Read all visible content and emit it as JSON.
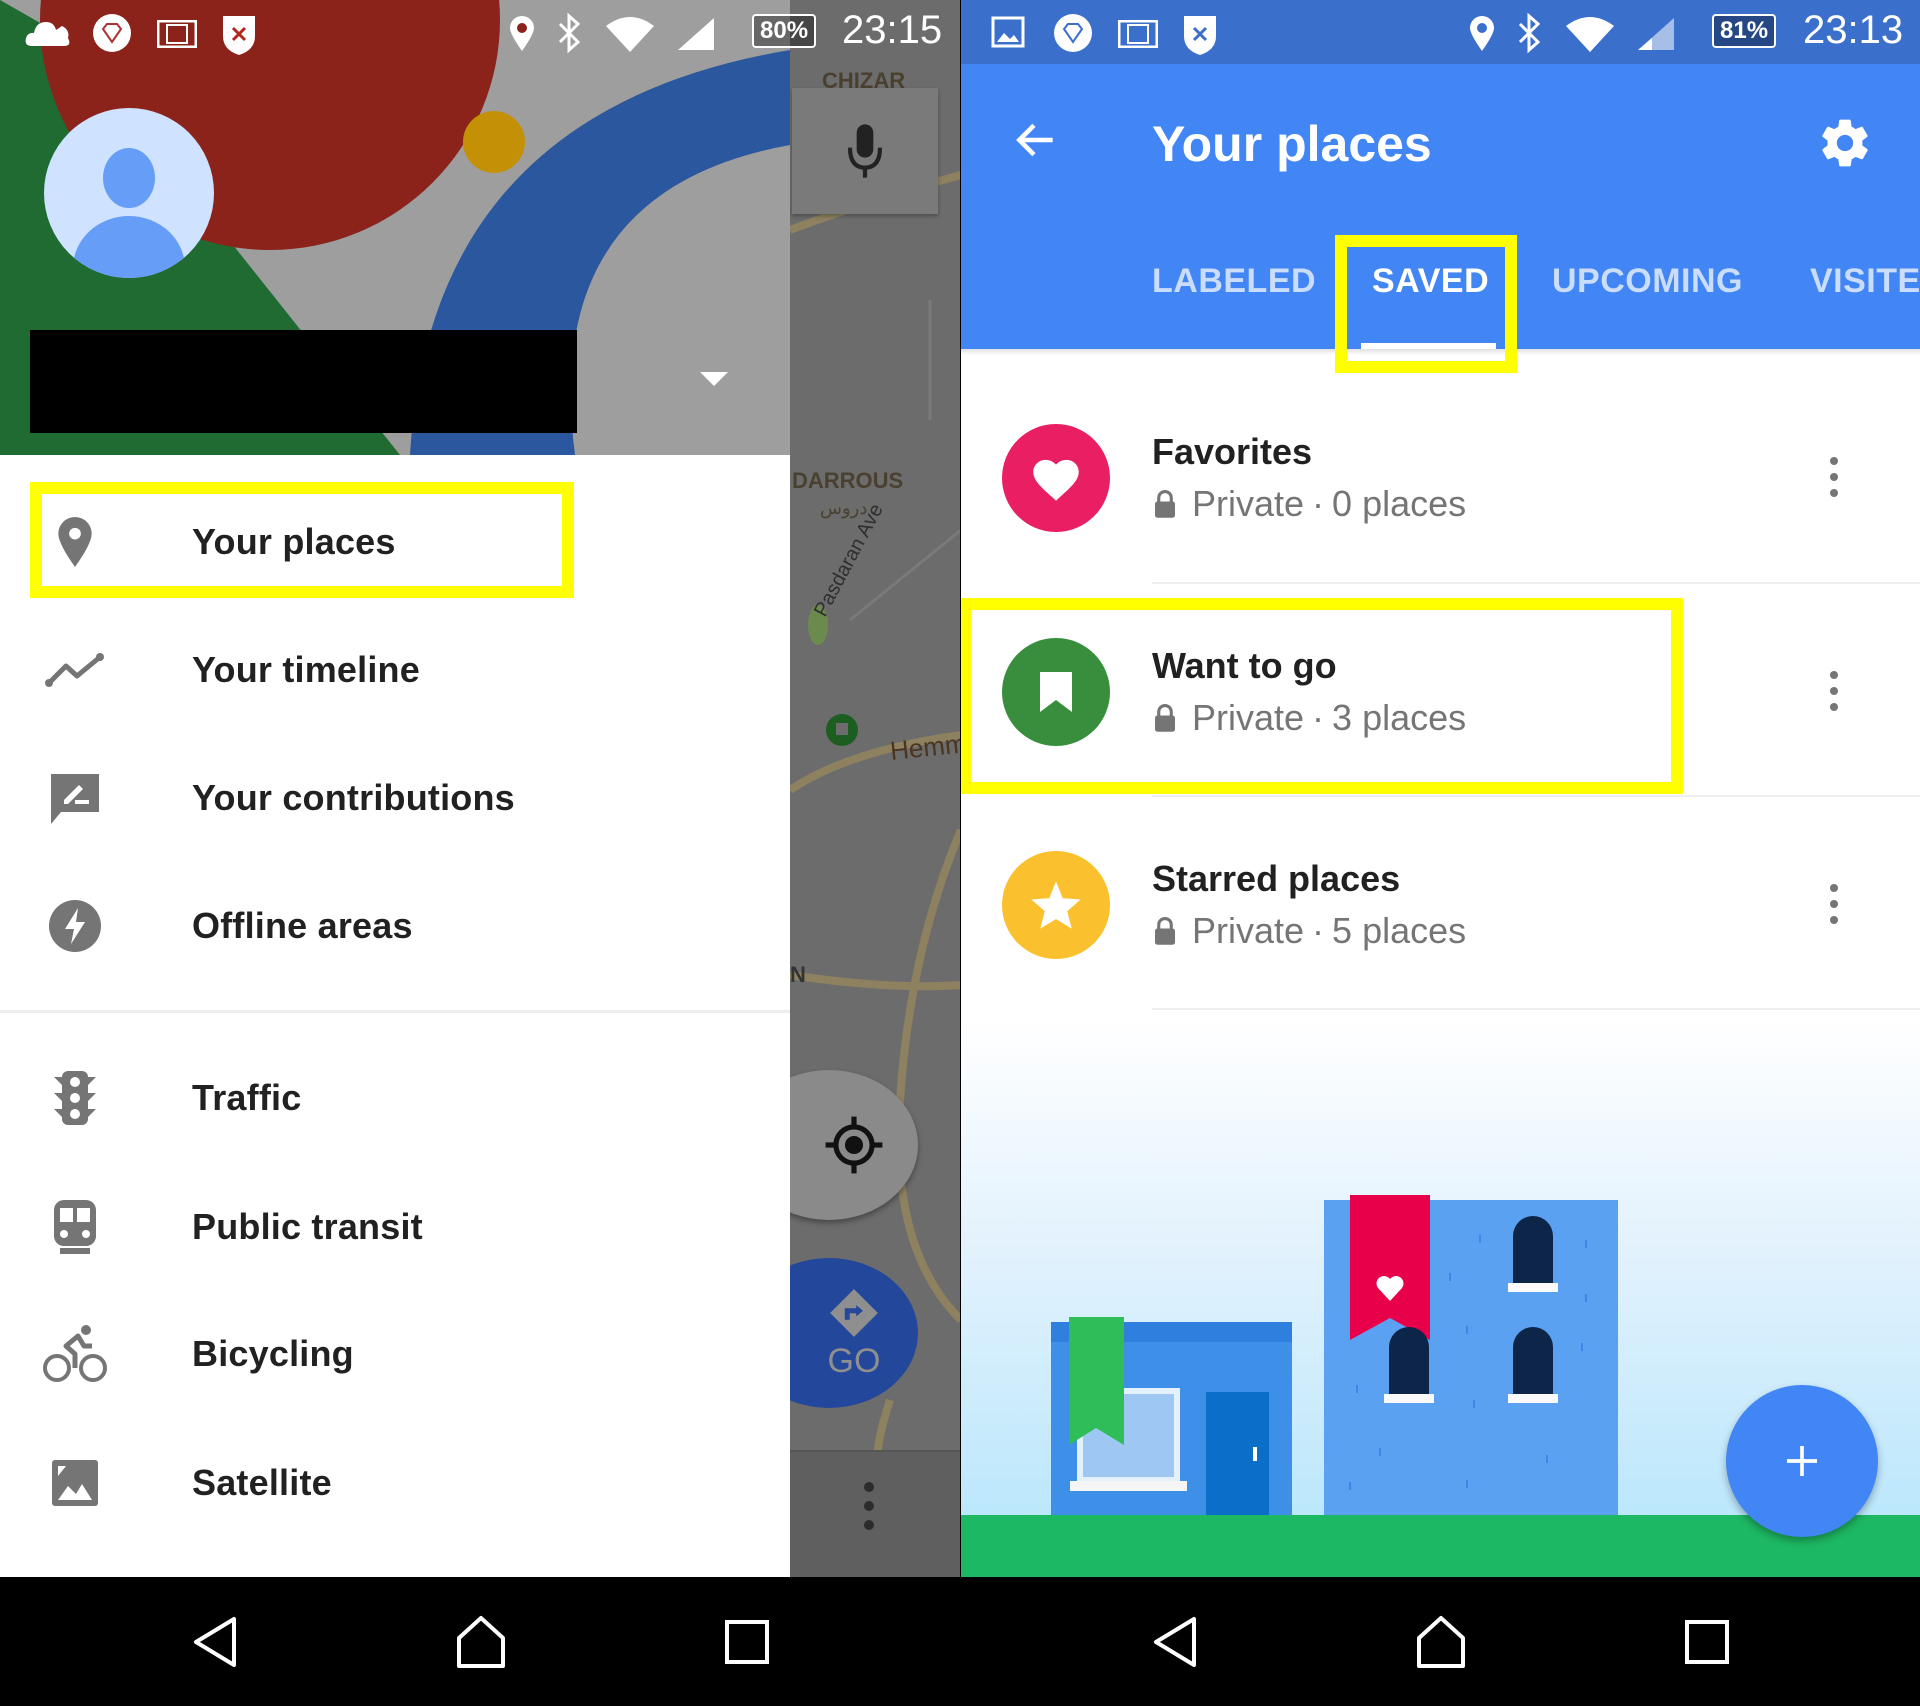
{
  "left_screen": {
    "status_bar": {
      "time": "23:15",
      "battery": "80%",
      "left_icons": [
        "cloud-icon",
        "diamond-icon",
        "film-icon",
        "shield-x-icon"
      ],
      "right_icons": [
        "location-icon",
        "bluetooth-icon",
        "wifi-icon",
        "signal-icon"
      ]
    },
    "drawer": {
      "account_name": "",
      "account_dropdown_icon": "caret-down-icon",
      "menu_items": [
        {
          "label": "Your places",
          "icon": "place-pin-icon",
          "highlighted": true
        },
        {
          "label": "Your timeline",
          "icon": "timeline-icon"
        },
        {
          "label": "Your contributions",
          "icon": "contributions-icon"
        },
        {
          "label": "Offline areas",
          "icon": "offline-bolt-icon"
        },
        {
          "label": "Traffic",
          "icon": "traffic-light-icon"
        },
        {
          "label": "Public transit",
          "icon": "train-icon"
        },
        {
          "label": "Bicycling",
          "icon": "bicycle-icon"
        },
        {
          "label": "Satellite",
          "icon": "satellite-icon"
        }
      ]
    },
    "map_background": {
      "labels": [
        "CHIZAR",
        "DARROUS",
        "دروس",
        "Pasdaran Ave",
        "Hemm",
        "N"
      ],
      "go_button_label": "GO"
    }
  },
  "right_screen": {
    "status_bar": {
      "time": "23:13",
      "battery": "81%",
      "left_icons": [
        "image-icon",
        "diamond-icon",
        "film-icon",
        "shield-x-icon"
      ],
      "right_icons": [
        "location-icon",
        "bluetooth-icon",
        "wifi-icon",
        "signal-icon"
      ]
    },
    "app_bar": {
      "title": "Your places",
      "back_icon": "arrow-back-icon",
      "settings_icon": "gear-icon"
    },
    "tabs": [
      {
        "label": "LABELED",
        "active": false
      },
      {
        "label": "SAVED",
        "active": true
      },
      {
        "label": "UPCOMING",
        "active": false
      },
      {
        "label": "VISITE",
        "active": false
      }
    ],
    "lists": [
      {
        "title": "Favorites",
        "privacy": "Private",
        "separator": "·",
        "count": "0 places",
        "icon": "heart-icon",
        "color": "#e91e63"
      },
      {
        "title": "Want to go",
        "privacy": "Private",
        "separator": "·",
        "count": "3 places",
        "icon": "bookmark-icon",
        "color": "#388e3c",
        "highlighted": true
      },
      {
        "title": "Starred places",
        "privacy": "Private",
        "separator": "·",
        "count": "5 places",
        "icon": "star-icon",
        "color": "#fbc02d"
      }
    ],
    "fab_icon": "plus-icon"
  },
  "nav_bar": {
    "buttons": [
      "back-triangle-icon",
      "home-icon",
      "recents-square-icon"
    ]
  },
  "colors": {
    "primary_blue": "#4285f4",
    "highlight_yellow": "#ffff00",
    "ground_green": "#1db863"
  }
}
